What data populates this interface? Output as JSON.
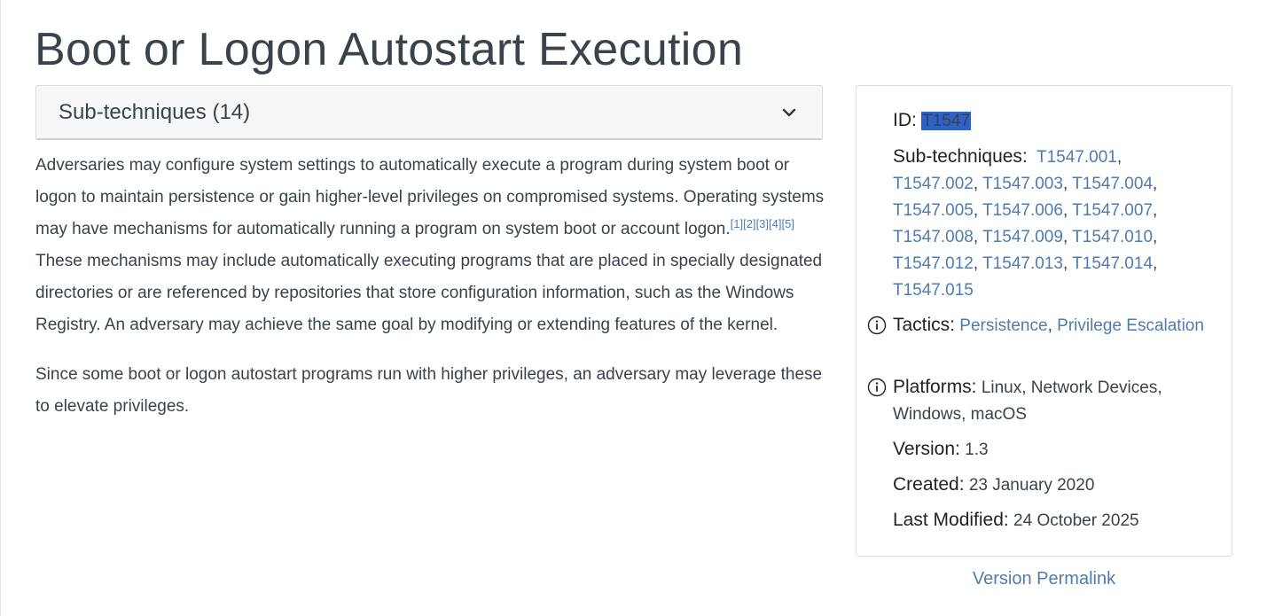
{
  "page": {
    "title": "Boot or Logon Autostart Execution"
  },
  "subtechniques_toggle": {
    "label": "Sub-techniques (14)"
  },
  "description": {
    "p1_a": "Adversaries may configure system settings to automatically execute a program during system boot or logon to maintain persistence or gain higher-level privileges on compromised systems. Operating systems may have mechanisms for automatically running a program on system boot or account logon.",
    "refs": [
      "[1]",
      "[2]",
      "[3]",
      "[4]",
      "[5]"
    ],
    "p1_b": " These mechanisms may include automatically executing programs that are placed in specially designated directories or are referenced by repositories that store configuration information, such as the Windows Registry. An adversary may achieve the same goal by modifying or extending features of the kernel.",
    "p2": "Since some boot or logon autostart programs run with higher privileges, an adversary may leverage these to elevate privileges."
  },
  "card": {
    "id_key": "ID:",
    "id_value": "T1547",
    "subtech_key": "Sub-techniques:",
    "subtechniques": [
      "T1547.001",
      "T1547.002",
      "T1547.003",
      "T1547.004",
      "T1547.005",
      "T1547.006",
      "T1547.007",
      "T1547.008",
      "T1547.009",
      "T1547.010",
      "T1547.012",
      "T1547.013",
      "T1547.014",
      "T1547.015"
    ],
    "tactics_key": "Tactics:",
    "tactics": [
      "Persistence",
      "Privilege Escalation"
    ],
    "platforms_key": "Platforms:",
    "platforms_value": "Linux, Network Devices, Windows, macOS",
    "version_key": "Version:",
    "version_value": "1.3",
    "created_key": "Created:",
    "created_value": "23 January 2020",
    "modified_key": "Last Modified:",
    "modified_value": "24 October 2025"
  },
  "permalink": {
    "label": "Version Permalink"
  },
  "icons": {
    "toggle": "chevron-down-icon",
    "info": "info-circle-icon"
  }
}
